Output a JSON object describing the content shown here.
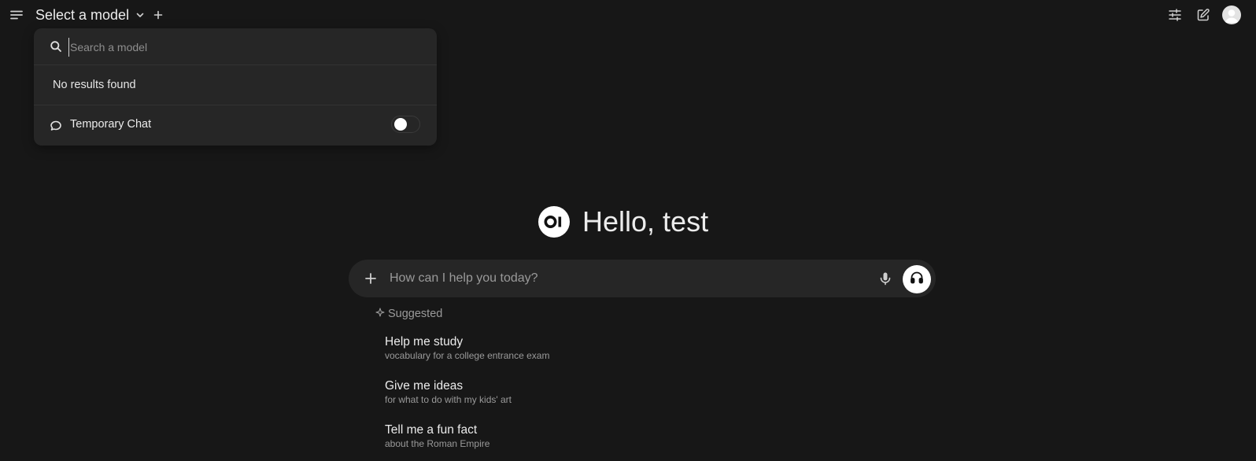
{
  "header": {
    "model_select_label": "Select a model",
    "icons": {
      "menu": "menu-icon",
      "chevron": "chevron-down-icon",
      "add": "plus-icon",
      "controls": "sliders-icon",
      "new_chat": "edit-icon",
      "avatar": "user-avatar"
    }
  },
  "dropdown": {
    "search_placeholder": "Search a model",
    "search_value": "",
    "empty_text": "No results found",
    "temporary_chat_label": "Temporary Chat",
    "temporary_chat_enabled": false
  },
  "main": {
    "greeting": "Hello, test",
    "prompt_placeholder": "How can I help you today?",
    "suggested_label": "Suggested",
    "suggestions": [
      {
        "title": "Help me study",
        "subtitle": "vocabulary for a college entrance exam"
      },
      {
        "title": "Give me ideas",
        "subtitle": "for what to do with my kids' art"
      },
      {
        "title": "Tell me a fun fact",
        "subtitle": "about the Roman Empire"
      }
    ]
  },
  "colors": {
    "background": "#171717",
    "panel": "#262626",
    "text": "#ececec",
    "muted_text": "#9a9a9a",
    "accent_button": "#ffffff"
  }
}
